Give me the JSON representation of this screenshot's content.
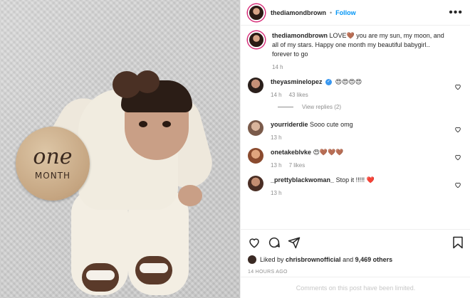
{
  "post": {
    "author": "thediamondbrown",
    "follow_label": "Follow",
    "separator": "•",
    "more_label": "•••"
  },
  "photo": {
    "plaque_big": "one",
    "plaque_small": "MONTH"
  },
  "caption": {
    "user": "thediamondbrown",
    "text": "LOVE🤎 you are my sun, my moon, and all of my stars. Happy one month my beautiful babygirl.. forever to go",
    "time": "14 h"
  },
  "comments": [
    {
      "user": "theyasminelopez",
      "verified": true,
      "text": "😍😍😍😍",
      "time": "14 h",
      "likes": "43 likes",
      "avatar_color": "#2a1f1b"
    },
    {
      "user": "yourriderdie",
      "verified": false,
      "text": "Sooo cute omg",
      "time": "13 h",
      "likes": "",
      "avatar_color": "#8a6a56"
    },
    {
      "user": "onetakeblvke",
      "verified": false,
      "text": "😍🤎🤎🤎",
      "time": "13 h",
      "likes": "7 likes",
      "avatar_color": "#9a5a3a"
    },
    {
      "user": "_prettyblackwoman_",
      "verified": false,
      "text": "Stop it !!!!! ❤️",
      "time": "13 h",
      "likes": "",
      "avatar_color": "#6a4a3e"
    }
  ],
  "view_replies": "View replies (2)",
  "likes_line": {
    "prefix": "Liked by",
    "user": "chrisbrownofficial",
    "and": "and",
    "others": "9,469 others"
  },
  "timestamp": "14 HOURS AGO",
  "limited_notice": "Comments on this post have been limited.",
  "colors": {
    "link": "#0095f6",
    "muted": "#8e8e8e",
    "heart_red": "#ed4956"
  },
  "icons": [
    "heart-icon",
    "comment-icon",
    "share-icon",
    "bookmark-icon",
    "more-icon",
    "verified-icon"
  ]
}
